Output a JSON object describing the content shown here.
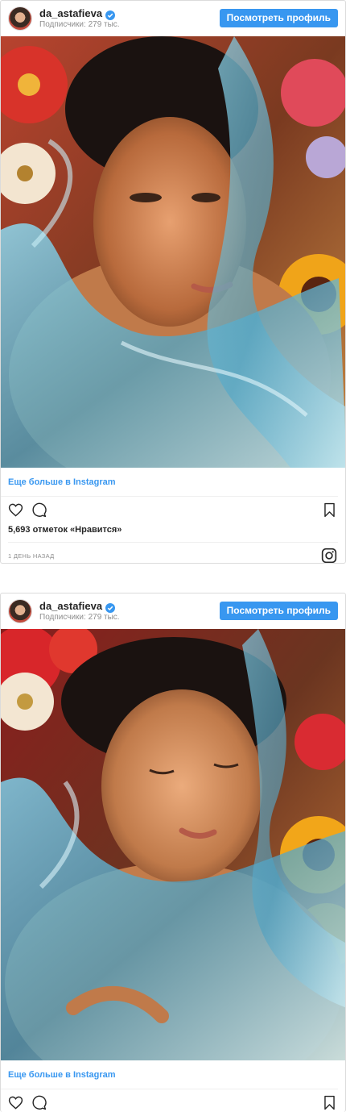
{
  "posts": [
    {
      "username": "da_astafieva",
      "followers": "Подписчики: 279 тыс.",
      "view_profile_label": "Посмотреть профиль",
      "more_link": "Еще больше в Instagram",
      "likes": "5,693 отметок «Нравится»",
      "timestamp": "1 ДЕНЬ НАЗАД"
    },
    {
      "username": "da_astafieva",
      "followers": "Подписчики: 279 тыс.",
      "view_profile_label": "Посмотреть профиль",
      "more_link": "Еще больше в Instagram"
    }
  ],
  "colors": {
    "accent": "#3897f0",
    "text": "#262626",
    "muted": "#8e8e8e",
    "border": "#dbdbdb"
  },
  "icons": [
    "verified-badge-icon",
    "heart-icon",
    "comment-icon",
    "bookmark-icon",
    "instagram-icon"
  ]
}
